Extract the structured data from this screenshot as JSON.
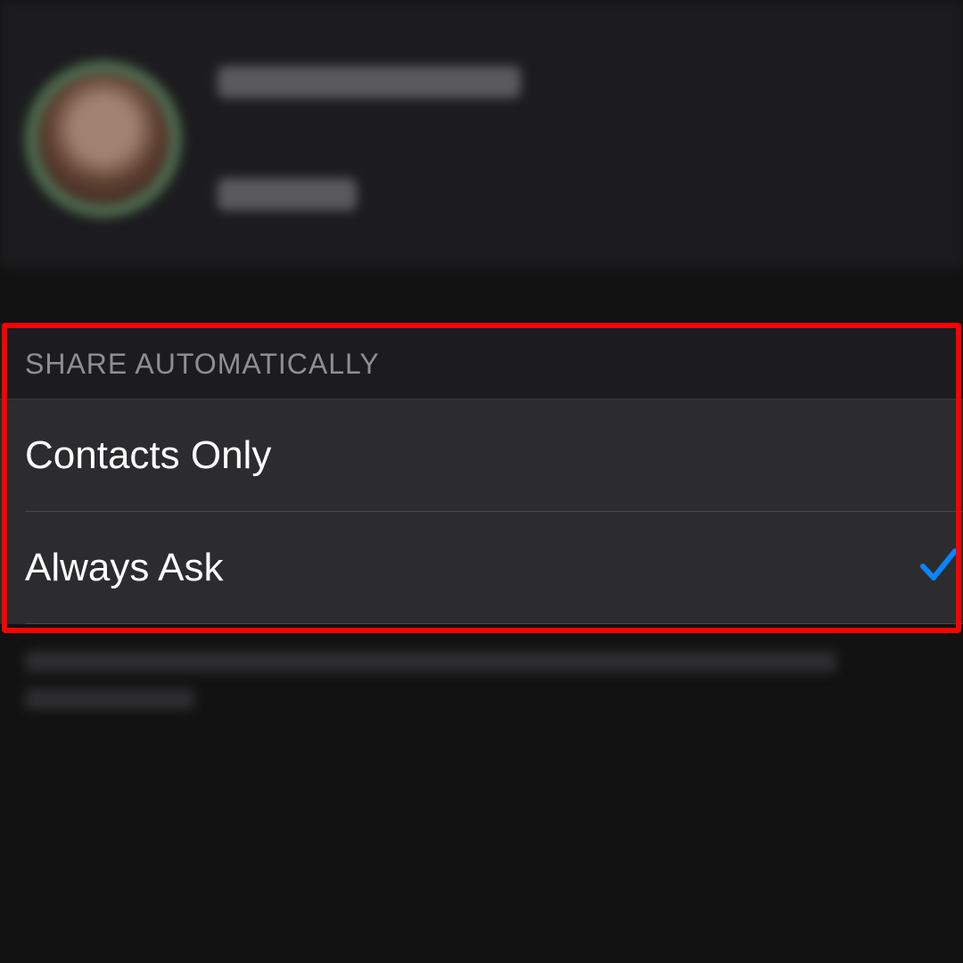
{
  "share_section": {
    "header": "SHARE AUTOMATICALLY",
    "options": [
      {
        "label": "Contacts Only",
        "selected": false
      },
      {
        "label": "Always Ask",
        "selected": true
      }
    ]
  },
  "colors": {
    "accent": "#0a84ff",
    "highlight_box": "#ff0000",
    "row_background": "#2c2c2e",
    "header_background": "#1c1c1e",
    "header_text": "#8e8e93"
  },
  "icons": {
    "selected_indicator": "checkmark-icon"
  }
}
